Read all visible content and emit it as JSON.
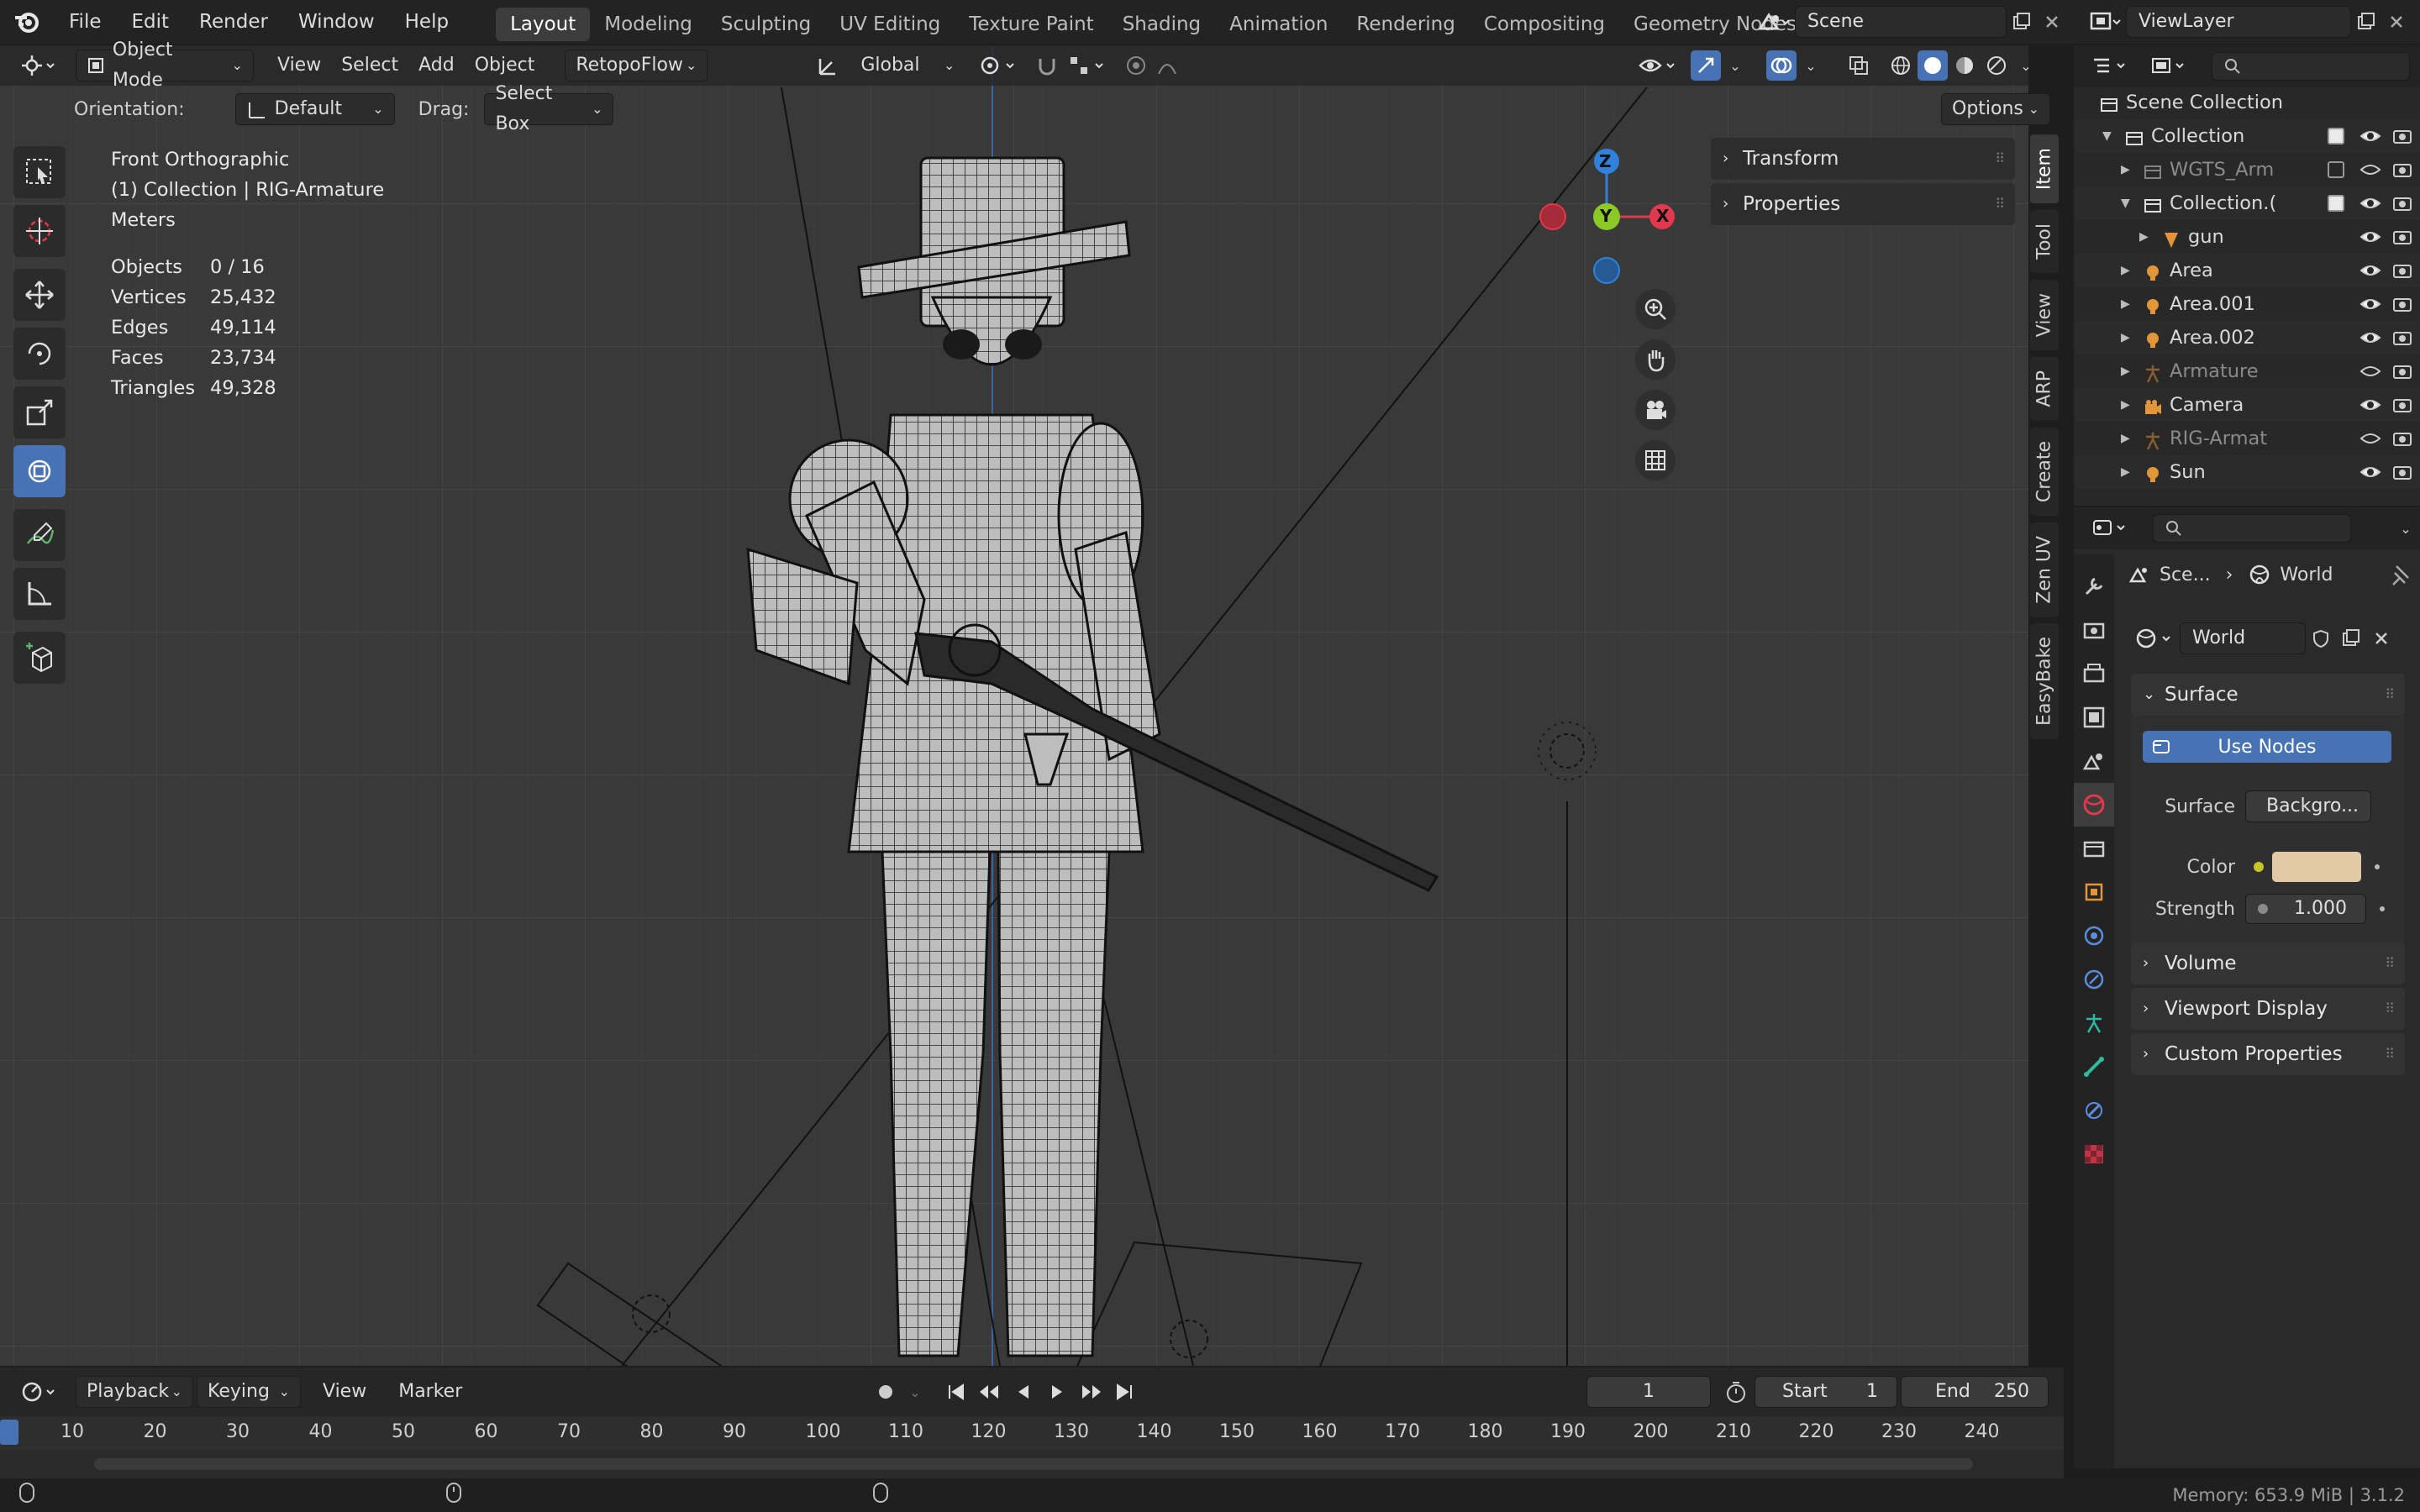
{
  "menus": [
    "File",
    "Edit",
    "Render",
    "Window",
    "Help"
  ],
  "workspaces": [
    "Layout",
    "Modeling",
    "Sculpting",
    "UV Editing",
    "Texture Paint",
    "Shading",
    "Animation",
    "Rendering",
    "Compositing",
    "Geometry Nodes"
  ],
  "active_workspace": "Layout",
  "scene_name": "Scene",
  "view_layer": "ViewLayer",
  "viewport_header": {
    "mode": "Object Mode",
    "menus": [
      "View",
      "Select",
      "Add",
      "Object"
    ],
    "addon_menu": "RetopoFlow",
    "transform_orientation": "Global"
  },
  "tool_header": {
    "orientation_label": "Orientation:",
    "orientation_value": "Default",
    "drag_label": "Drag:",
    "drag_value": "Select Box",
    "options": "Options"
  },
  "overlay_info": {
    "view_name": "Front Orthographic",
    "context": "(1) Collection | RIG-Armature",
    "units": "Meters"
  },
  "stats": [
    {
      "label": "Objects",
      "value": "0 / 16"
    },
    {
      "label": "Vertices",
      "value": "25,432"
    },
    {
      "label": "Edges",
      "value": "49,114"
    },
    {
      "label": "Faces",
      "value": "23,734"
    },
    {
      "label": "Triangles",
      "value": "49,328"
    }
  ],
  "gizmo": {
    "z": "Z",
    "y": "Y",
    "x": "X"
  },
  "npanel": {
    "panels": [
      "Transform",
      "Properties"
    ],
    "tabs": [
      "Item",
      "Tool",
      "View",
      "ARP",
      "Create",
      "Zen UV",
      "EasyBake"
    ],
    "active_tab": "Item"
  },
  "outliner": {
    "root": "Scene Collection",
    "items": [
      {
        "label": "Collection",
        "indent": 1,
        "expanded": true
      },
      {
        "label": "WGTS_Arm",
        "indent": 2,
        "dim": true
      },
      {
        "label": "Collection.(",
        "indent": 2,
        "expanded": true
      },
      {
        "label": "gun",
        "indent": 3
      },
      {
        "label": "Area",
        "indent": 2
      },
      {
        "label": "Area.001",
        "indent": 2
      },
      {
        "label": "Area.002",
        "indent": 2
      },
      {
        "label": "Armature",
        "indent": 2,
        "dim": true
      },
      {
        "label": "Camera",
        "indent": 2
      },
      {
        "label": "RIG-Armat",
        "indent": 2,
        "dim": true
      },
      {
        "label": "Sun",
        "indent": 2
      }
    ]
  },
  "properties": {
    "breadcrumb_scene": "Sce...",
    "breadcrumb_world": "World",
    "world_name": "World",
    "surface_panel": "Surface",
    "use_nodes": "Use Nodes",
    "surface_label": "Surface",
    "surface_value": "Backgro...",
    "color_label": "Color",
    "color_value": "#e2c9a6",
    "strength_label": "Strength",
    "strength_value": "1.000",
    "collapsed_panels": [
      "Volume",
      "Viewport Display",
      "Custom Properties"
    ]
  },
  "timeline": {
    "menus": [
      "Playback",
      "Keying",
      "View",
      "Marker"
    ],
    "current_frame": "1",
    "start_label": "Start",
    "start_value": "1",
    "end_label": "End",
    "end_value": "250",
    "ruler": [
      "10",
      "20",
      "30",
      "40",
      "50",
      "60",
      "70",
      "80",
      "90",
      "100",
      "110",
      "120",
      "130",
      "140",
      "150",
      "160",
      "170",
      "180",
      "190",
      "200",
      "210",
      "220",
      "230",
      "240"
    ]
  },
  "statusbar": {
    "memory": "Memory: 653.9 MiB | 3.1.2"
  },
  "colors": {
    "accent": "#4772b3",
    "gizmo_x": "#e0384c",
    "gizmo_y": "#8ac926",
    "gizmo_z": "#2f82d9"
  }
}
